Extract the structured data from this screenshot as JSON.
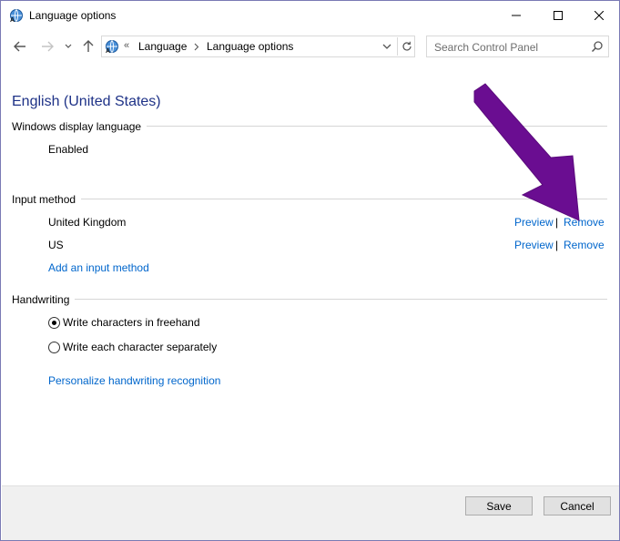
{
  "window": {
    "title": "Language options"
  },
  "nav": {
    "breadcrumb_prefix": "«",
    "breadcrumbs": [
      "Language",
      "Language options"
    ],
    "search_placeholder": "Search Control Panel"
  },
  "main": {
    "heading": "English (United States)",
    "display_language": {
      "label": "Windows display language",
      "status": "Enabled"
    },
    "input_method": {
      "label": "Input method",
      "items": [
        {
          "name": "United Kingdom",
          "preview": "Preview",
          "remove": "Remove"
        },
        {
          "name": "US",
          "preview": "Preview",
          "remove": "Remove"
        }
      ],
      "add_link": "Add an input method"
    },
    "handwriting": {
      "label": "Handwriting",
      "options": [
        {
          "label": "Write characters in freehand",
          "checked": true
        },
        {
          "label": "Write each character separately",
          "checked": false
        }
      ],
      "personalize_link": "Personalize handwriting recognition"
    }
  },
  "footer": {
    "save": "Save",
    "cancel": "Cancel"
  },
  "colors": {
    "link": "#0066cc",
    "heading": "#1e3287",
    "annotation_arrow": "#6a0d91"
  }
}
